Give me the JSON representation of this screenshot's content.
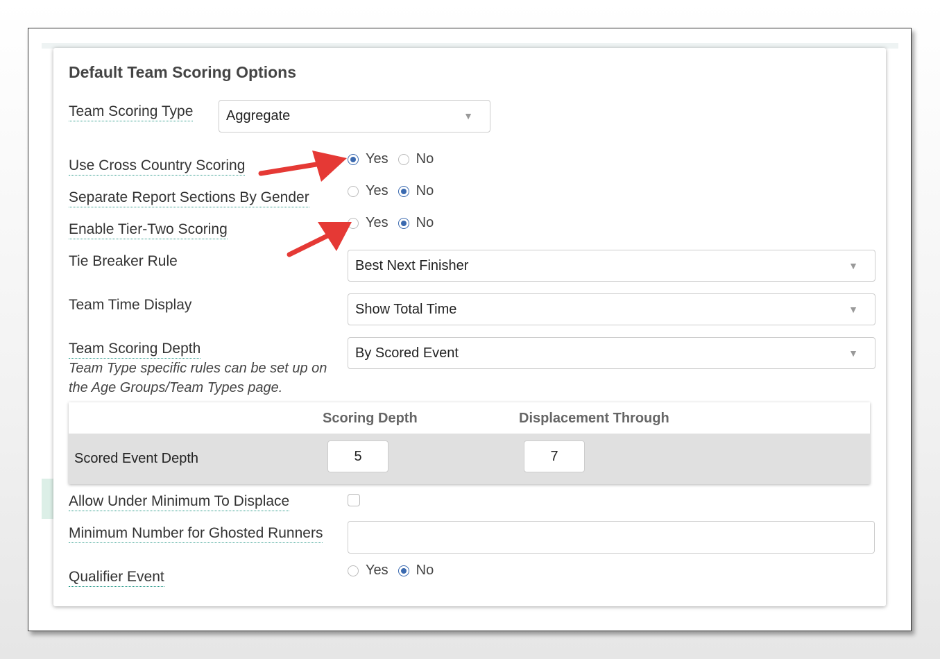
{
  "modal": {
    "title": "Default Team Scoring Options",
    "team_scoring_type": {
      "label": "Team Scoring Type",
      "value": "Aggregate"
    },
    "cross_country": {
      "label": "Use Cross Country Scoring",
      "yes": "Yes",
      "no": "No",
      "selected": "Yes"
    },
    "separate_gender": {
      "label": "Separate Report Sections By Gender",
      "yes": "Yes",
      "no": "No",
      "selected": "No"
    },
    "tier_two": {
      "label": "Enable Tier-Two Scoring",
      "yes": "Yes",
      "no": "No",
      "selected": "No"
    },
    "tie_breaker": {
      "label": "Tie Breaker Rule",
      "value": "Best Next Finisher"
    },
    "team_time_display": {
      "label": "Team Time Display",
      "value": "Show Total Time"
    },
    "scoring_depth": {
      "label": "Team Scoring Depth",
      "help": "Team Type specific rules can be set up on the Age Groups/Team Types page.",
      "value": "By Scored Event"
    },
    "depth_table": {
      "col_scoring_depth": "Scoring Depth",
      "col_displacement": "Displacement Through",
      "row_label": "Scored Event Depth",
      "scoring_depth_value": "5",
      "displacement_value": "7"
    },
    "allow_under_min": {
      "label": "Allow Under Minimum To Displace",
      "checked": false
    },
    "min_ghosted": {
      "label": "Minimum Number for Ghosted Runners",
      "value": ""
    },
    "qualifier": {
      "label": "Qualifier Event",
      "yes": "Yes",
      "no": "No",
      "selected": "No"
    }
  },
  "colors": {
    "radio_selected": "#3b6ab0",
    "annotation_arrow": "#e53935",
    "label_underline": "#2a9a8a"
  }
}
